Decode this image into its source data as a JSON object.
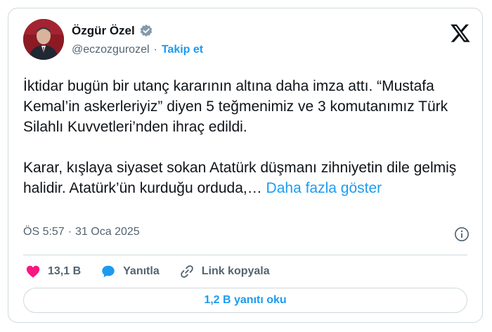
{
  "author": {
    "name": "Özgür Özel",
    "handle": "@eczozgurozel",
    "separator": "·",
    "follow_label": "Takip et"
  },
  "tweet": {
    "paragraph1": "İktidar bugün bir utanç kararının altına daha imza attı. “Mustafa Kemal’in askerleriyiz” diyen 5 teğmenimiz ve 3 komutanımız Türk Silahlı Kuvvetleri’nden ihraç edildi.",
    "paragraph2": "Karar, kışlaya siyaset sokan Atatürk düşmanı zihniyetin dile gelmiş halidir. Atatürk’ün kurduğu orduda,… ",
    "show_more": "Daha fazla göster"
  },
  "meta": {
    "time": "ÖS 5:57",
    "separator": "·",
    "date": "31 Oca 2025"
  },
  "actions": {
    "likes": "13,1 B",
    "reply_label": "Yanıtla",
    "copy_link_label": "Link kopyala"
  },
  "read_replies_label": "1,2 B yanıtı oku",
  "colors": {
    "accent": "#1d9bf0",
    "like": "#f91880",
    "text": "#0f1419",
    "muted": "#536471",
    "border": "#cfd9de"
  },
  "icons": [
    "verified-badge-icon",
    "x-logo-icon",
    "info-icon",
    "heart-icon",
    "reply-bubble-icon",
    "link-icon"
  ]
}
